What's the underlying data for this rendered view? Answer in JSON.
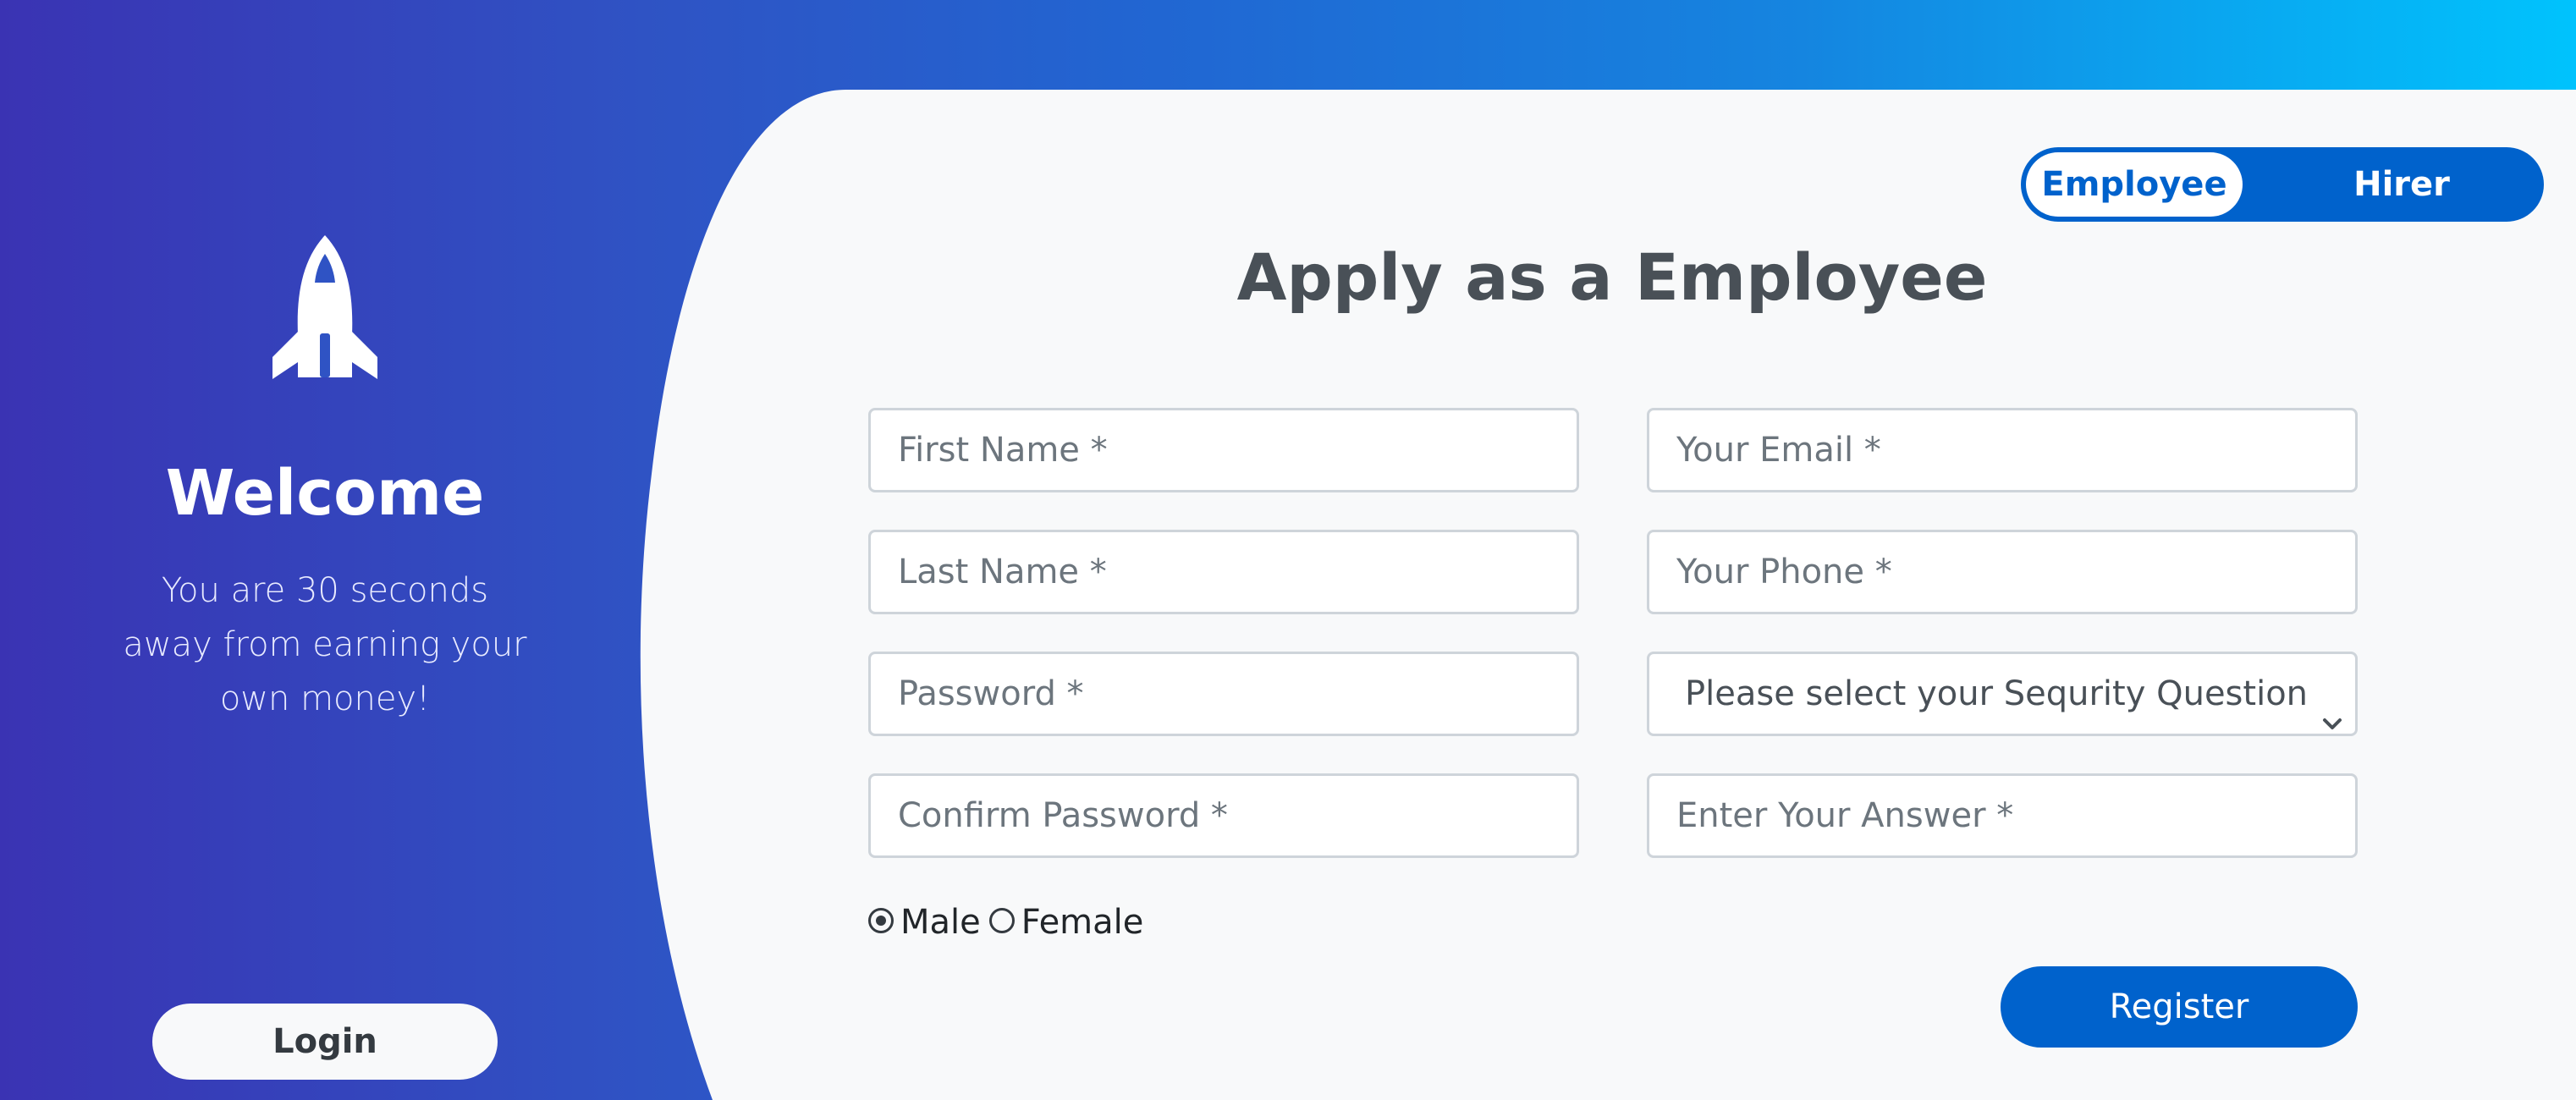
{
  "sidebar": {
    "icon": "rocket-icon",
    "title": "Welcome",
    "subtitle": "You are 30 seconds away from earning your own money!",
    "login_label": "Login"
  },
  "toggle": {
    "options": [
      "Employee",
      "Hirer"
    ],
    "selected": "Employee"
  },
  "form": {
    "title": "Apply as a Employee",
    "fields": {
      "first_name": "First Name *",
      "last_name": "Last Name *",
      "password": "Password *",
      "confirm_password": "Confirm Password *",
      "email": "Your Email *",
      "phone": "Your Phone *",
      "security_question": "Please select your Sequrity Question",
      "answer": "Enter Your Answer *"
    },
    "gender": {
      "options": [
        "Male",
        "Female"
      ],
      "selected": "Male"
    },
    "register_label": "Register"
  },
  "colors": {
    "gradient_start": "#3a33b3",
    "gradient_end": "#00c3fd",
    "panel_bg": "#f8f9fa",
    "primary": "#0062cc",
    "title_text": "#495057"
  }
}
